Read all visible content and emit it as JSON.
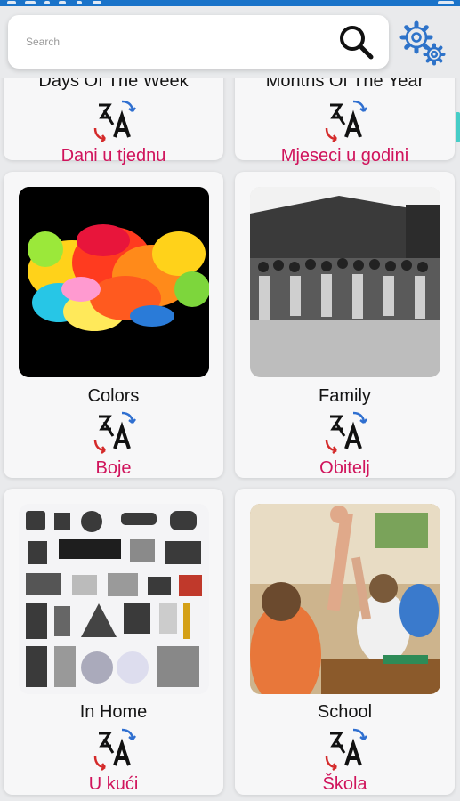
{
  "search": {
    "placeholder": "Search"
  },
  "colors": {
    "statusbar": "#1a73c9",
    "accent_text": "#d0145c",
    "gear": "#2e73c9",
    "scroll_indicator": "#46cdc7"
  },
  "icons": {
    "search": "search-icon",
    "settings": "gear-icon",
    "translate": "translate-icon"
  },
  "categories": [
    {
      "english": "Days Of The Week",
      "croatian": "Dani u tjednu",
      "image": "none"
    },
    {
      "english": "Months Of The Year",
      "croatian": "Mjeseci u godini",
      "image": "none"
    },
    {
      "english": "Colors",
      "croatian": "Boje",
      "image": "paint-powder-explosion"
    },
    {
      "english": "Family",
      "croatian": "Obitelj",
      "image": "family-group-photo"
    },
    {
      "english": "In Home",
      "croatian": "U kući",
      "image": "home-appliances"
    },
    {
      "english": "School",
      "croatian": "Škola",
      "image": "classroom-students"
    }
  ]
}
